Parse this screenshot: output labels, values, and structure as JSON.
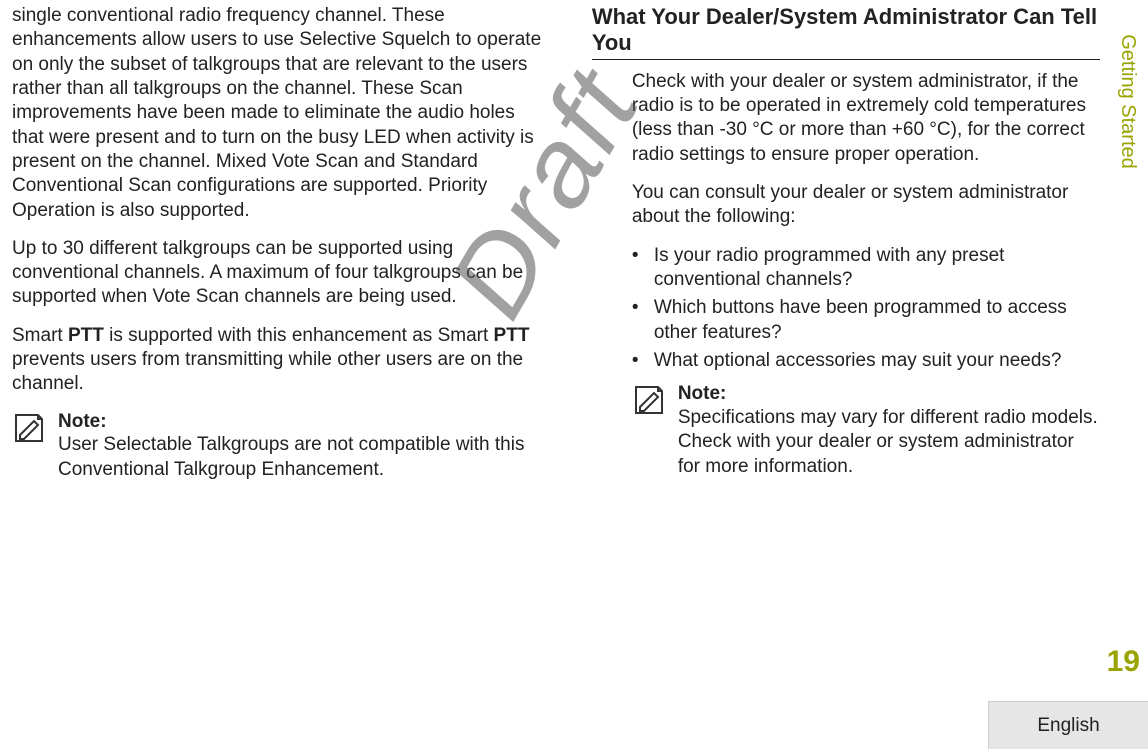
{
  "watermark": "Draft",
  "sideTab": "Getting Started",
  "pageNumber": "19",
  "language": "English",
  "left": {
    "para1": "single conventional radio frequency channel. These enhancements allow users to use Selective Squelch to operate on only the subset of talkgroups that are relevant to the users rather than all talkgroups on the channel. These Scan improvements have been made to eliminate the audio holes that were present and to turn on the busy LED when activity is present on the channel. Mixed Vote Scan and Standard Conventional Scan configurations are supported. Priority Operation is also supported.",
    "para2": "Up to 30 different talkgroups can be supported using conventional channels. A maximum of four talkgroups can be supported when Vote Scan channels are being used.",
    "para3_pre": "Smart ",
    "para3_ptt1": "PTT",
    "para3_mid": " is supported with this enhancement as Smart ",
    "para3_ptt2": "PTT",
    "para3_post": " prevents users from transmitting while other users are on the channel.",
    "note": {
      "title": "Note:",
      "text": "User Selectable Talkgroups are not compatible with this Conventional Talkgroup Enhancement."
    }
  },
  "right": {
    "heading": "What Your Dealer/System Administrator Can Tell You",
    "para1": "Check with your dealer or system administrator, if the radio is to be operated in extremely cold temperatures (less than -30 °C or more than +60 °C), for the correct radio settings to ensure proper operation.",
    "para2": "You can consult your dealer or system administrator about the following:",
    "bullets": [
      "Is your radio programmed with any preset conventional channels?",
      "Which buttons have been programmed to access other features?",
      "What optional accessories may suit your needs?"
    ],
    "note": {
      "title": "Note:",
      "text": "Specifications may vary for different radio models. Check with your dealer or system administrator for more information."
    }
  }
}
